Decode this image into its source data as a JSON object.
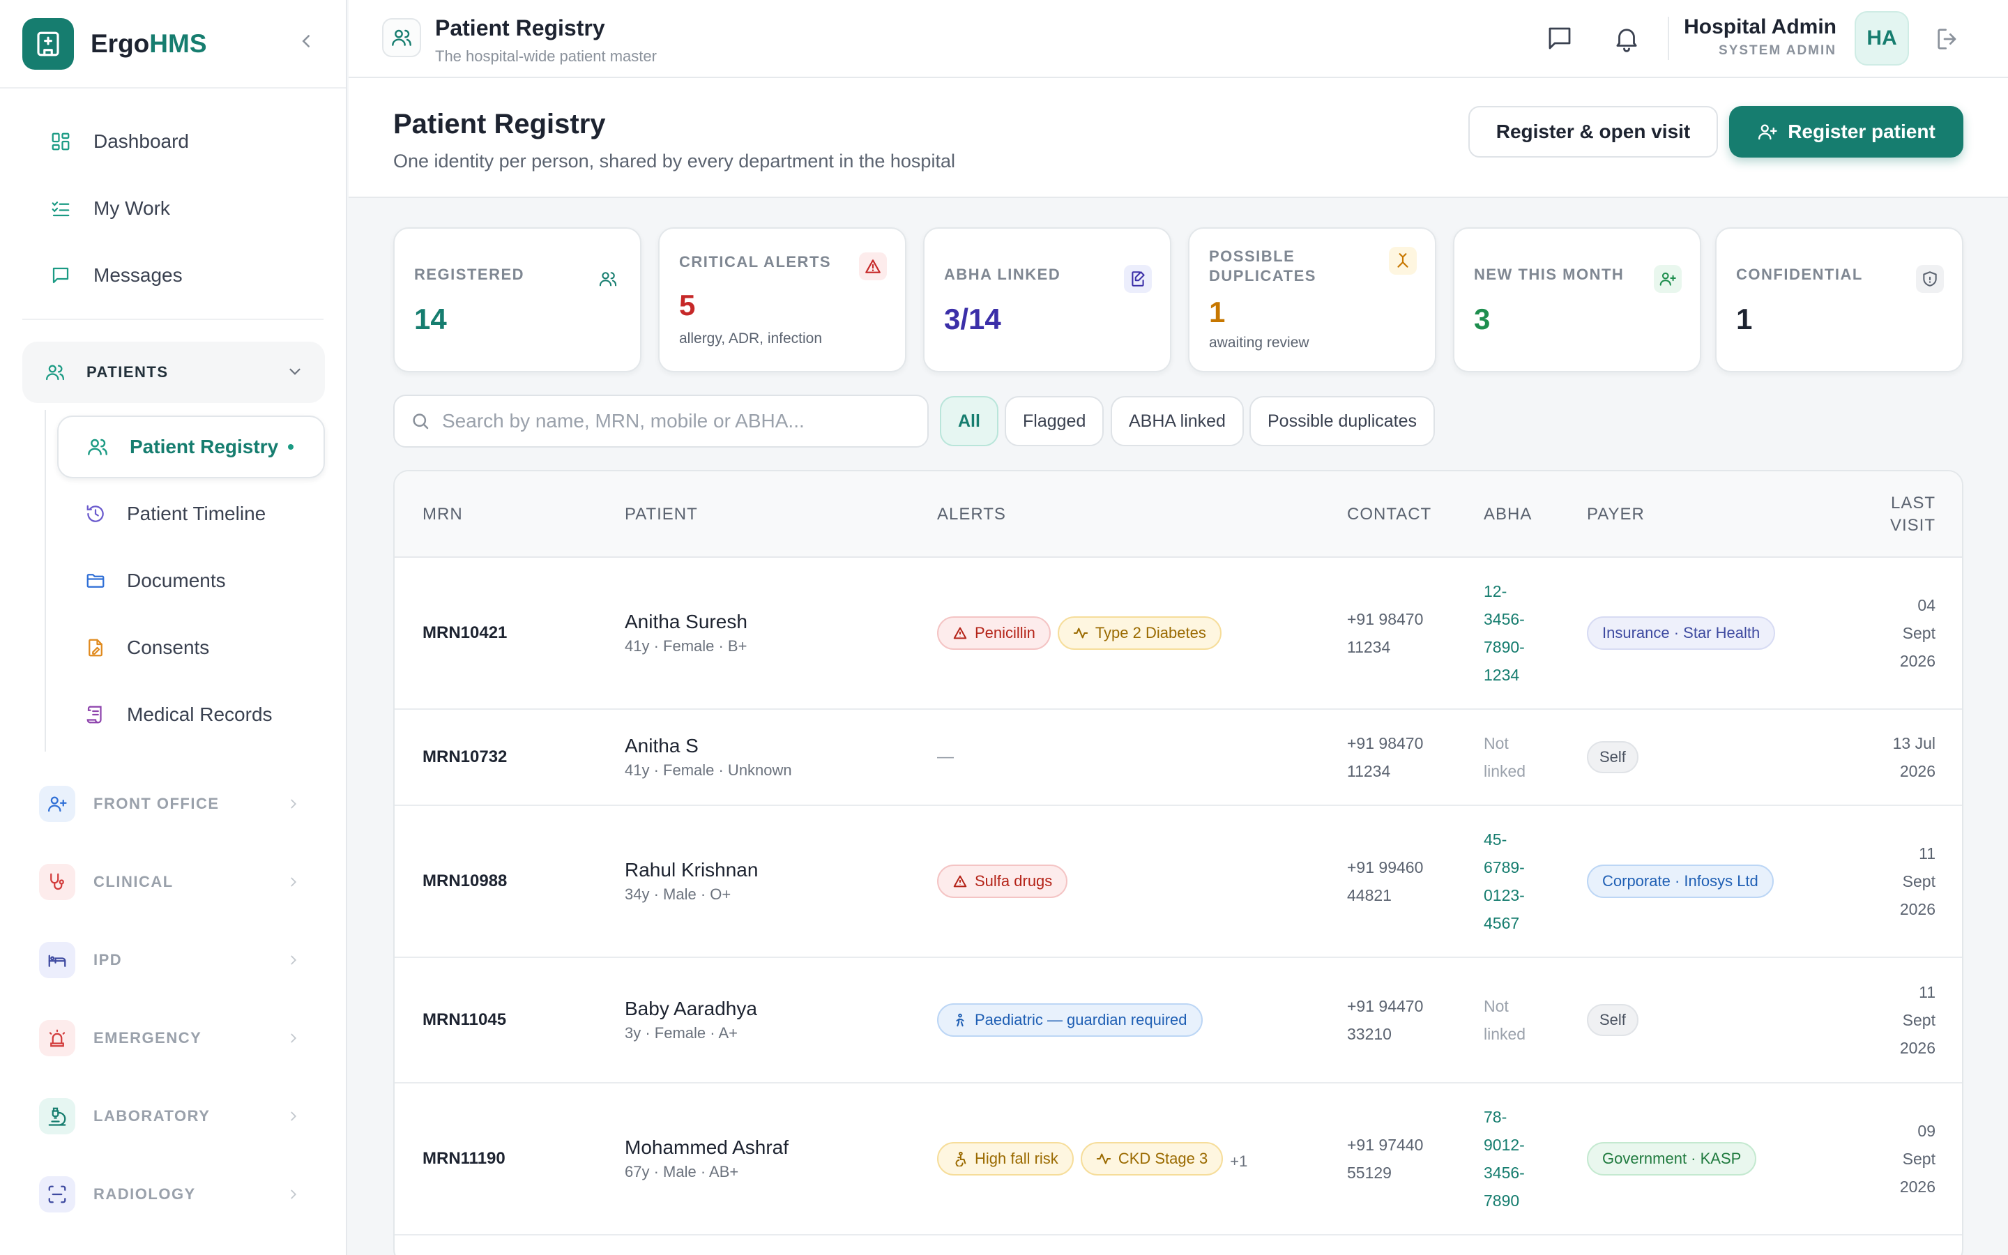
{
  "app": {
    "brand_a": "Ergo",
    "brand_b": "HMS"
  },
  "sidebar": {
    "top": [
      {
        "label": "Dashboard"
      },
      {
        "label": "My Work"
      },
      {
        "label": "Messages"
      }
    ],
    "group": {
      "label": "PATIENTS"
    },
    "sub": [
      {
        "label": "Patient Registry"
      },
      {
        "label": "Patient Timeline"
      },
      {
        "label": "Documents"
      },
      {
        "label": "Consents"
      },
      {
        "label": "Medical Records"
      }
    ],
    "sections": [
      {
        "label": "FRONT OFFICE"
      },
      {
        "label": "CLINICAL"
      },
      {
        "label": "IPD"
      },
      {
        "label": "EMERGENCY"
      },
      {
        "label": "LABORATORY"
      },
      {
        "label": "RADIOLOGY"
      }
    ]
  },
  "header": {
    "title": "Patient Registry",
    "subtitle": "The hospital-wide patient master",
    "user_name": "Hospital Admin",
    "user_role": "SYSTEM ADMIN",
    "avatar": "HA"
  },
  "page": {
    "title": "Patient Registry",
    "subtitle": "One identity per person, shared by every department in the hospital",
    "btn_secondary": "Register & open visit",
    "btn_primary": "Register patient"
  },
  "stats": [
    {
      "label": "REGISTERED",
      "value": "14",
      "color": "#167d6f"
    },
    {
      "label": "CRITICAL ALERTS",
      "value": "5",
      "sub": "allergy, ADR, infection",
      "color": "#c62828"
    },
    {
      "label": "ABHA LINKED",
      "value": "3/14",
      "color": "#3b2fa8"
    },
    {
      "label": "POSSIBLE DUPLICATES",
      "value": "1",
      "sub": "awaiting review",
      "color": "#c77700"
    },
    {
      "label": "NEW THIS MONTH",
      "value": "3",
      "color": "#1e8e4e"
    },
    {
      "label": "CONFIDENTIAL",
      "value": "1",
      "color": "#1d2330"
    }
  ],
  "search": {
    "placeholder": "Search by name, MRN, mobile or ABHA..."
  },
  "filters": [
    "All",
    "Flagged",
    "ABHA linked",
    "Possible duplicates"
  ],
  "table": {
    "columns": {
      "mrn": "MRN",
      "patient": "PATIENT",
      "alerts": "ALERTS",
      "contact": "CONTACT",
      "abha": "ABHA",
      "payer": "PAYER",
      "last_a": "LAST",
      "last_b": "VISIT"
    },
    "rows": [
      {
        "mrn": "MRN10421",
        "name": "Anitha Suresh",
        "meta": "41y · Female · B+",
        "alerts": [
          {
            "text": "Penicillin"
          },
          {
            "text": "Type 2 Diabetes"
          }
        ],
        "contact": [
          "+91 98470",
          "11234"
        ],
        "abha": [
          "12-",
          "3456-",
          "7890-",
          "1234"
        ],
        "payer": "Insurance · Star Health",
        "last": [
          "04",
          "Sept",
          "2026"
        ]
      },
      {
        "mrn": "MRN10732",
        "name": "Anitha S",
        "meta": "41y · Female · Unknown",
        "alerts_empty": "—",
        "contact": [
          "+91 98470",
          "11234"
        ],
        "abha": [
          "Not",
          "linked"
        ],
        "payer": "Self",
        "last": [
          "13 Jul",
          "2026"
        ]
      },
      {
        "mrn": "MRN10988",
        "name": "Rahul Krishnan",
        "meta": "34y · Male · O+",
        "alerts": [
          {
            "text": "Sulfa drugs"
          }
        ],
        "contact": [
          "+91 99460",
          "44821"
        ],
        "abha": [
          "45-",
          "6789-",
          "0123-",
          "4567"
        ],
        "payer": "Corporate · Infosys Ltd",
        "last": [
          "11",
          "Sept",
          "2026"
        ]
      },
      {
        "mrn": "MRN11045",
        "name": "Baby Aaradhya",
        "meta": "3y · Female · A+",
        "alerts": [
          {
            "text": "Paediatric — guardian required"
          }
        ],
        "contact": [
          "+91 94470",
          "33210"
        ],
        "abha": [
          "Not",
          "linked"
        ],
        "payer": "Self",
        "last": [
          "11",
          "Sept",
          "2026"
        ]
      },
      {
        "mrn": "MRN11190",
        "name": "Mohammed Ashraf",
        "meta": "67y · Male · AB+",
        "alerts": [
          {
            "text": "High fall risk"
          },
          {
            "text": "CKD Stage 3"
          }
        ],
        "more": "+1",
        "contact": [
          "+91 97440",
          "55129"
        ],
        "abha": [
          "78-",
          "9012-",
          "3456-",
          "7890"
        ],
        "payer": "Government · KASP",
        "last": [
          "09",
          "Sept",
          "2026"
        ]
      }
    ]
  }
}
